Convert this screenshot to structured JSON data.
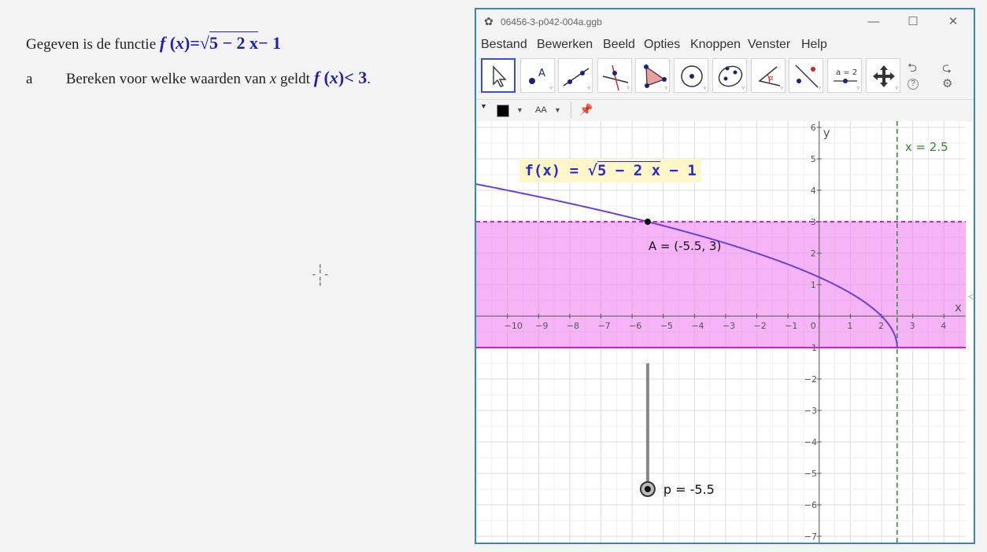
{
  "document": {
    "intro": "Gegeven is de functie",
    "question_letter": "a",
    "question_text": "Bereken voor welke waarden van",
    "question_var": "x",
    "question_text2": "geldt",
    "formula_f": "f",
    "formula_x": "x",
    "formula_eq": "=",
    "formula_radicand": "5 − 2 x",
    "formula_tail": "− 1",
    "ineq": "< 3",
    "period": "."
  },
  "window": {
    "title": "06456-3-p042-004a.ggb",
    "minimize": "—",
    "maximize": "☐",
    "close": "✕"
  },
  "menu": [
    "Bestand",
    "Bewerken",
    "Beeld",
    "Opties",
    "Knoppen",
    "Venster",
    "Help"
  ],
  "toolbar": {
    "tools": [
      {
        "name": "move-tool-icon"
      },
      {
        "name": "point-tool-icon",
        "label": "A"
      },
      {
        "name": "line-tool-icon"
      },
      {
        "name": "perpendicular-line-tool-icon"
      },
      {
        "name": "polygon-tool-icon"
      },
      {
        "name": "circle-tool-icon"
      },
      {
        "name": "conic-tool-icon"
      },
      {
        "name": "angle-tool-icon",
        "label": "α"
      },
      {
        "name": "reflect-tool-icon"
      },
      {
        "name": "slider-tool-icon",
        "label": "a = 2"
      },
      {
        "name": "move-graphics-view-icon"
      }
    ],
    "undo_icon": "⮌",
    "redo_icon": "⮎",
    "help_icon": "?",
    "settings_icon": "⚙"
  },
  "stylebar": {
    "aa_label": "AA",
    "color": "#000000"
  },
  "graph": {
    "x_range": [
      -11.0,
      4.7
    ],
    "y_range": [
      -7.2,
      6.2
    ],
    "x_ticks": [
      -10,
      -9,
      -8,
      -7,
      -6,
      -5,
      -4,
      -3,
      -2,
      -1,
      0,
      1,
      2,
      3,
      4
    ],
    "y_ticks": [
      -7,
      -6,
      -5,
      -4,
      -3,
      -2,
      -1,
      1,
      2,
      3,
      4,
      5,
      6
    ],
    "x_axis_label": "x",
    "y_axis_label": "y",
    "function_label": "f(x)  =  √5 − 2 x − 1",
    "function_label_parts": {
      "lhs": "f(x)  =  ",
      "radicand": "5 − 2 x",
      "rhs": " − 1"
    },
    "function_color": "#6a3fe0",
    "shade_color": "#ee82ee",
    "shade_y_range": [
      -1,
      3
    ],
    "upper_line_y": 3,
    "lower_line_y": -1,
    "vertical_line_x": 2.5,
    "vertical_line_label": "x = 2.5",
    "vertical_line_color": "#2e8b2e",
    "point_A": {
      "x": -5.5,
      "y": 3,
      "label": "A = (-5.5, 3)"
    },
    "slider": {
      "label": "p = -5.5",
      "value": -5.5,
      "x": -5.5,
      "y_top": -1.5,
      "y_bottom": -5.5
    }
  }
}
